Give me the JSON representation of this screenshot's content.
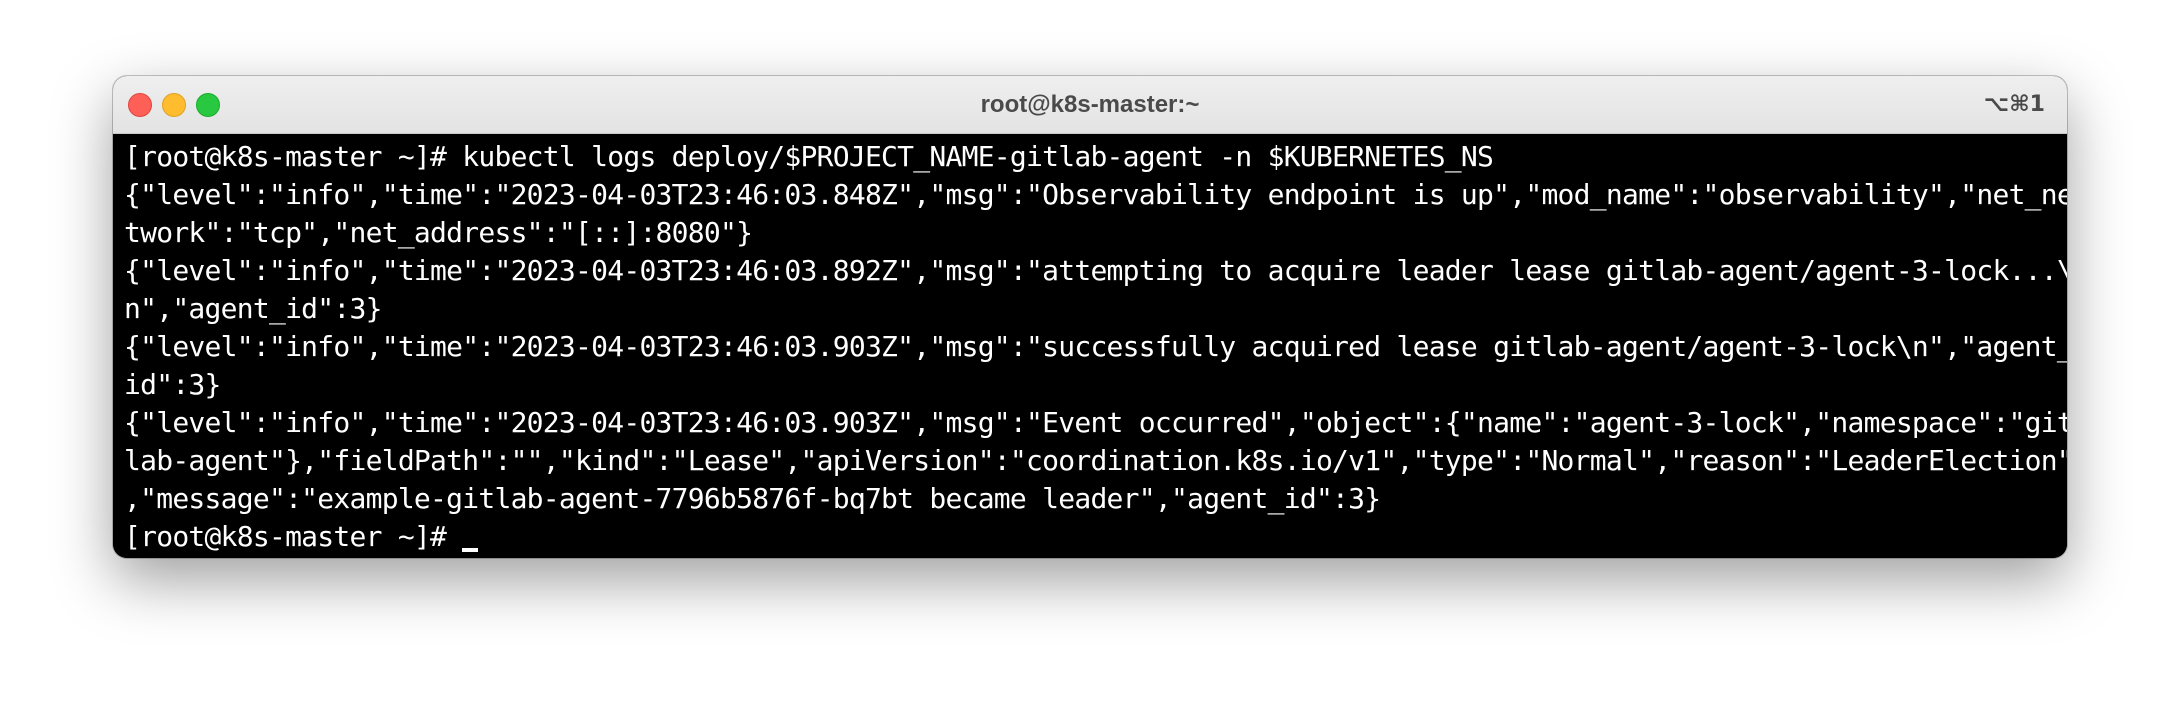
{
  "window": {
    "title": "root@k8s-master:~",
    "shortcut": "⌥⌘1"
  },
  "terminal": {
    "lines": [
      "[root@k8s-master ~]# kubectl logs deploy/$PROJECT_NAME-gitlab-agent -n $KUBERNETES_NS",
      "{\"level\":\"info\",\"time\":\"2023-04-03T23:46:03.848Z\",\"msg\":\"Observability endpoint is up\",\"mod_name\":\"observability\",\"net_ne",
      "twork\":\"tcp\",\"net_address\":\"[::]:8080\"}",
      "{\"level\":\"info\",\"time\":\"2023-04-03T23:46:03.892Z\",\"msg\":\"attempting to acquire leader lease gitlab-agent/agent-3-lock...\\",
      "n\",\"agent_id\":3}",
      "{\"level\":\"info\",\"time\":\"2023-04-03T23:46:03.903Z\",\"msg\":\"successfully acquired lease gitlab-agent/agent-3-lock\\n\",\"agent_",
      "id\":3}",
      "{\"level\":\"info\",\"time\":\"2023-04-03T23:46:03.903Z\",\"msg\":\"Event occurred\",\"object\":{\"name\":\"agent-3-lock\",\"namespace\":\"git",
      "lab-agent\"},\"fieldPath\":\"\",\"kind\":\"Lease\",\"apiVersion\":\"coordination.k8s.io/v1\",\"type\":\"Normal\",\"reason\":\"LeaderElection\"",
      ",\"message\":\"example-gitlab-agent-7796b5876f-bq7bt became leader\",\"agent_id\":3}"
    ],
    "prompt": "[root@k8s-master ~]#"
  },
  "colors": {
    "terminal_background": "#000000",
    "terminal_text": "#ffffff",
    "close": "#fe5f57",
    "minimize": "#febc2e",
    "zoom": "#28c840"
  }
}
